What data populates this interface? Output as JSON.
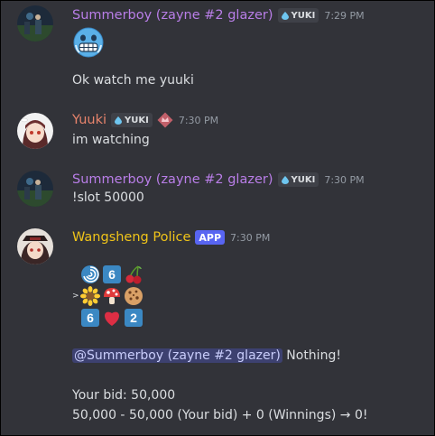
{
  "messages": [
    {
      "author": "Summerboy (zayne #2 glazer)",
      "author_color": "#b97ee8",
      "tag": "YUKI",
      "time": "7:29 PM",
      "emoji": "cold-face-emoji",
      "text": "Ok watch me yuuki"
    },
    {
      "author": "Yuuki",
      "author_color": "#e8846c",
      "tag": "YUKI",
      "badge_icon": "pink-crown-badge-icon",
      "time": "7:30 PM",
      "text": "im watching"
    },
    {
      "author": "Summerboy (zayne #2 glazer)",
      "author_color": "#b97ee8",
      "tag": "YUKI",
      "time": "7:30 PM",
      "text": "!slot 50000"
    },
    {
      "author": "Wangsheng Police",
      "author_color": "#f0c419",
      "app_tag": "APP",
      "time": "7:30 PM",
      "slot_arrow": ">",
      "slot_rows": [
        [
          "cyclone-emoji",
          "keycap-6-emoji",
          "cherries-emoji"
        ],
        [
          "sunflower-emoji",
          "mushroom-emoji",
          "cookie-emoji"
        ],
        [
          "keycap-6-emoji",
          "red-heart-emoji",
          "keycap-2-emoji"
        ]
      ],
      "keycaps": {
        "six": "6",
        "two": "2"
      },
      "mention": "@Summerboy (zayne #2 glazer)",
      "result": " Nothing!",
      "bid_line": "Your bid: 50,000",
      "calc_line": "50,000 - 50,000 (Your bid) + 0 (Winnings) → 0!"
    }
  ],
  "colors": {
    "background": "#323339",
    "text": "#dbdee1",
    "timestamp": "#949ba4",
    "app_tag": "#5865f2",
    "keycap": "#3b88c3"
  }
}
